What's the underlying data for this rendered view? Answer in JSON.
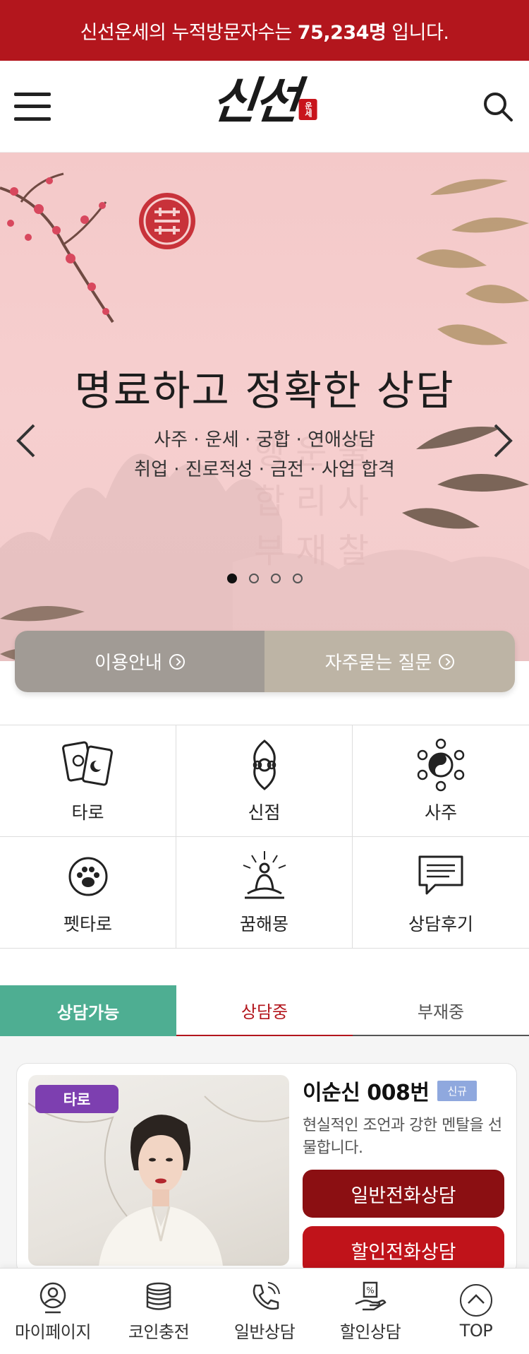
{
  "notice": {
    "prefix": "신선운세의 누적방문자수는",
    "count": "75,234명",
    "suffix": "입니다."
  },
  "header": {
    "logo_text": "신선",
    "logo_seal": "운세",
    "menu_icon": "hamburger-menu-icon",
    "search_icon": "search-icon"
  },
  "hero": {
    "title": "명료하고 정확한 상담",
    "sub_line1": "사주 · 운세 · 궁합 · 연애상담",
    "sub_line2": "취업 · 진로적성 · 금전 · 사업 합격",
    "slide_count": 4,
    "active_slide": 1
  },
  "guide": {
    "usage_label": "이용안내",
    "faq_label": "자주묻는 질문"
  },
  "categories": [
    {
      "label": "타로",
      "icon": "tarot-cards-icon"
    },
    {
      "label": "신점",
      "icon": "shinjeom-icon"
    },
    {
      "label": "사주",
      "icon": "yin-yang-icon"
    },
    {
      "label": "펫타로",
      "icon": "paw-icon"
    },
    {
      "label": "꿈해몽",
      "icon": "meditation-icon"
    },
    {
      "label": "상담후기",
      "icon": "speech-bubble-icon"
    }
  ],
  "tabs": {
    "available": "상담가능",
    "in_session": "상담중",
    "absent": "부재중"
  },
  "counselor": {
    "category_badge": "타로",
    "name": "이순신 008번",
    "new_badge": "신규",
    "description": "현실적인 조언과 강한 멘탈을 선물합니다.",
    "normal_call": "일반전화상담",
    "discount_call": "할인전화상담"
  },
  "bottom_nav": [
    {
      "label": "마이페이지",
      "icon": "user-icon"
    },
    {
      "label": "코인충전",
      "icon": "coins-icon"
    },
    {
      "label": "일반상담",
      "icon": "phone-icon"
    },
    {
      "label": "할인상담",
      "icon": "discount-hand-icon"
    },
    {
      "label": "TOP",
      "icon": "arrow-up-circle-icon"
    }
  ],
  "colors": {
    "brand_red": "#b3161d",
    "dark_red": "#8b0f12",
    "teal_tab": "#4eae92",
    "hero_pink": "#f4c9c9",
    "tarot_purple": "#7d3fb0"
  }
}
